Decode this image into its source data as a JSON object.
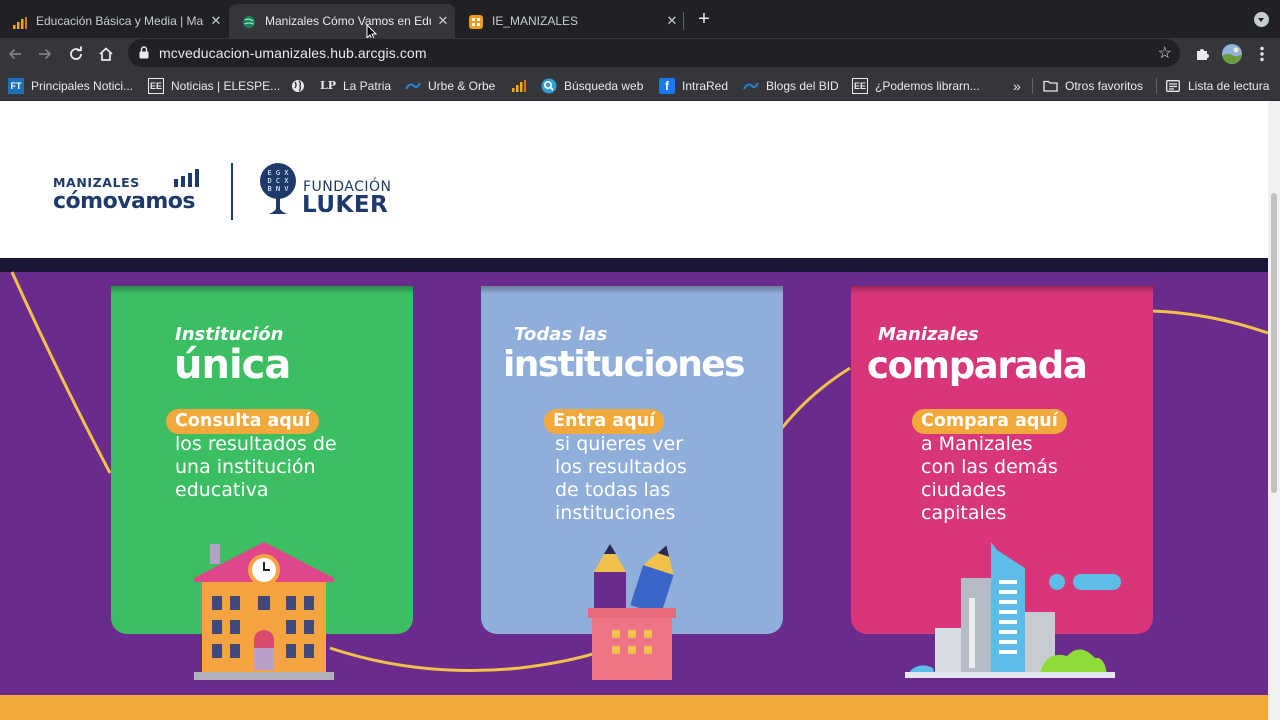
{
  "browser": {
    "tabs": [
      {
        "title": "Educación Básica y Media | Ma",
        "icon": "bar-chart-favicon",
        "active": false
      },
      {
        "title": "Manizales Cómo Vamos en Edu",
        "icon": "globe-favicon",
        "active": true
      },
      {
        "title": "IE_MANIZALES",
        "icon": "arcgis-favicon",
        "active": false
      }
    ],
    "close_glyph": "✕",
    "newtab_glyph": "+",
    "url": "mcveducacion-umanizales.hub.arcgis.com",
    "bookmarks": [
      {
        "label": "Principales Notici...",
        "icon": "ft-icon",
        "glyph": "FT"
      },
      {
        "label": "Noticias | ELESPE...",
        "icon": "ee-icon",
        "glyph": "EE"
      },
      {
        "label": "",
        "icon": "globe-icon",
        "glyph": ""
      },
      {
        "label": "La Patria",
        "icon": "lp-icon",
        "glyph": "LP"
      },
      {
        "label": "Urbe & Orbe",
        "icon": "wave-icon",
        "glyph": ""
      },
      {
        "label": "",
        "icon": "bar-chart-icon",
        "glyph": ""
      },
      {
        "label": "Búsqueda web",
        "icon": "search-icon",
        "glyph": ""
      },
      {
        "label": "IntraRed",
        "icon": "facebook-icon",
        "glyph": "f"
      },
      {
        "label": "Blogs del BID",
        "icon": "wave-icon",
        "glyph": ""
      },
      {
        "label": "¿Podemos librarn...",
        "icon": "ee-icon",
        "glyph": "EE"
      }
    ],
    "bookmarks_more": "»",
    "other_bookmarks": "Otros favoritos",
    "reading_list": "Lista de lectura"
  },
  "header": {
    "logo_top": "MANIZALES",
    "logo_bottom": "cómovamos",
    "partner_line1": "FUNDACIÓN",
    "partner_line2": "LUKER",
    "partner_tree_letters": "EGXDCXBNV"
  },
  "cards": [
    {
      "id": "unica",
      "color": "#3cbf63",
      "subtitle": "Institución",
      "title": "única",
      "cta": "Consulta aquí",
      "description": "los resultados de\nuna institución\neducativa"
    },
    {
      "id": "todas",
      "color": "#8faed9",
      "subtitle": "Todas las",
      "title": "instituciones",
      "cta": "Entra aquí",
      "description": "si quieres ver\nlos resultados\nde todas las\ninstituciones"
    },
    {
      "id": "comparada",
      "color": "#d8357a",
      "subtitle": "Manizales",
      "title": "comparada",
      "cta": "Compara aquí",
      "description": "a Manizales\ncon las demás\nciudades\ncapitales"
    }
  ],
  "colors": {
    "banner": "#6b2b8c",
    "accent_orange": "#f0a93a",
    "navy": "#1d3a6b"
  }
}
